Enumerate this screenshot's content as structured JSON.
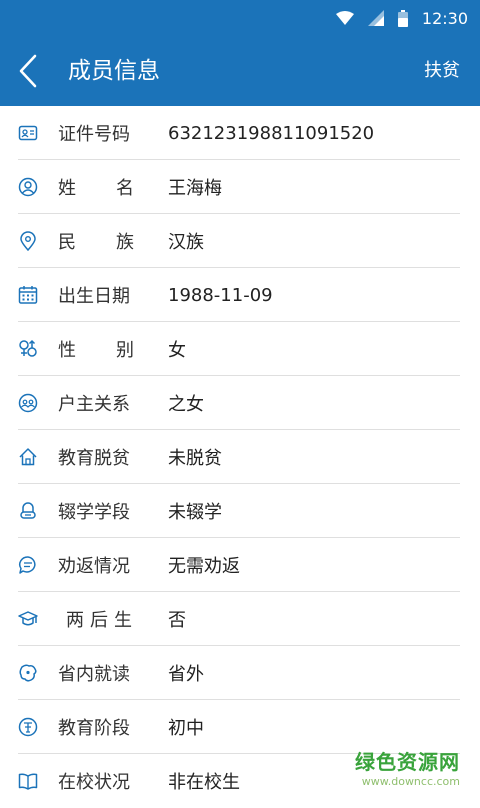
{
  "status_bar": {
    "time": "12:30"
  },
  "app_bar": {
    "title": "成员信息",
    "action": "扶贫"
  },
  "fields": [
    {
      "label": "证件号码",
      "value": "632123198811091520",
      "icon": "id-card-icon",
      "align": "normal"
    },
    {
      "label": "姓名",
      "value": "王海梅",
      "icon": "user-icon",
      "align": "spread"
    },
    {
      "label": "民族",
      "value": "汉族",
      "icon": "location-pin-icon",
      "align": "spread"
    },
    {
      "label": "出生日期",
      "value": "1988-11-09",
      "icon": "calendar-icon",
      "align": "normal"
    },
    {
      "label": "性别",
      "value": "女",
      "icon": "gender-icon",
      "align": "spread"
    },
    {
      "label": "户主关系",
      "value": "之女",
      "icon": "relation-icon",
      "align": "normal"
    },
    {
      "label": "教育脱贫",
      "value": "未脱贫",
      "icon": "home-icon",
      "align": "normal"
    },
    {
      "label": "辍学学段",
      "value": "未辍学",
      "icon": "student-icon",
      "align": "normal"
    },
    {
      "label": "劝返情况",
      "value": "无需劝返",
      "icon": "chat-icon",
      "align": "normal"
    },
    {
      "label": "两后生",
      "value": "否",
      "icon": "graduation-cap-icon",
      "align": "center3"
    },
    {
      "label": "省内就读",
      "value": "省外",
      "icon": "province-map-icon",
      "align": "normal"
    },
    {
      "label": "教育阶段",
      "value": "初中",
      "icon": "study-icon",
      "align": "normal"
    },
    {
      "label": "在校状况",
      "value": "非在校生",
      "icon": "book-icon",
      "align": "normal"
    }
  ],
  "watermark": {
    "line1": "绿色资源网",
    "line2": "www.downcc.com"
  },
  "colors": {
    "primary": "#1b73b9",
    "icon": "#1b73b9",
    "divider": "#dfdfdf"
  }
}
